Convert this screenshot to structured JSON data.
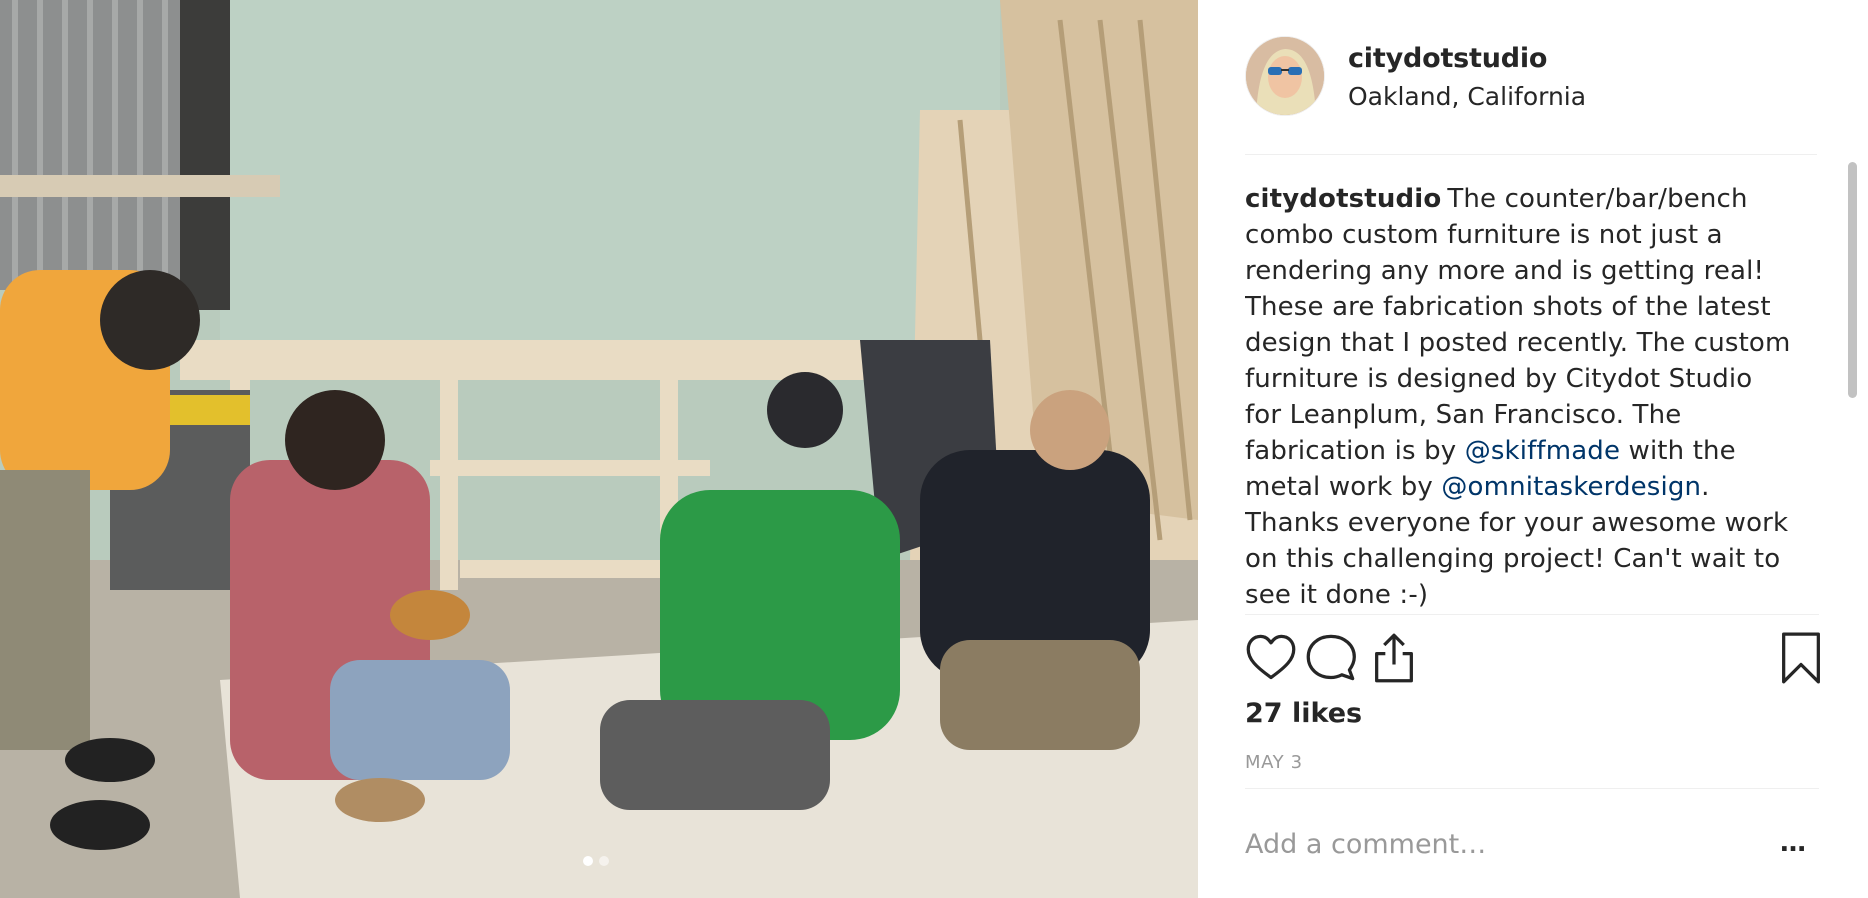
{
  "post": {
    "username": "citydotstudio",
    "location": "Oakland, California",
    "caption_user": "citydotstudio",
    "caption_part1": "The counter/bar/bench combo custom furniture is not just a rendering any more and is getting real! These are fabrication shots of the latest design that I posted recently. The custom furniture is designed by Citydot Studio for Leanplum, San Francisco. The fabrication is by ",
    "mention1": "@skiffmade",
    "caption_part2": " with the metal work by ",
    "mention2": "@omnitaskerdesign",
    "caption_part3": ". Thanks everyone for your awesome work on this challenging project! Can't wait to see it done :-)",
    "likes": "27 likes",
    "date": "MAY 3",
    "comment_placeholder": "Add a comment…",
    "more_label": "…"
  },
  "carousel": {
    "count": 2,
    "active": 1
  },
  "icons": {
    "like": "heart-icon",
    "comment": "comment-icon",
    "share": "share-icon",
    "save": "bookmark-icon",
    "more": "more-icon"
  },
  "colors": {
    "mention": "#003569",
    "text": "#262626",
    "muted": "#999999",
    "divider": "#efefef"
  }
}
